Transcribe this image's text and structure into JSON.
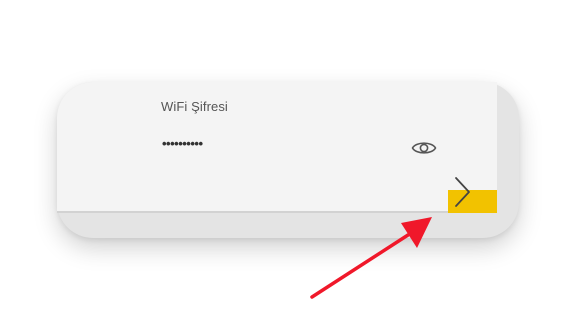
{
  "wifi_password": {
    "label": "WiFi Şifresi",
    "value": "••••••••••",
    "show_password_icon": "eye-icon",
    "next_icon": "chevron-right-icon"
  },
  "colors": {
    "accent": "#f2c200",
    "annotation_arrow": "#f0182a",
    "card_background": "#f4f4f4"
  }
}
